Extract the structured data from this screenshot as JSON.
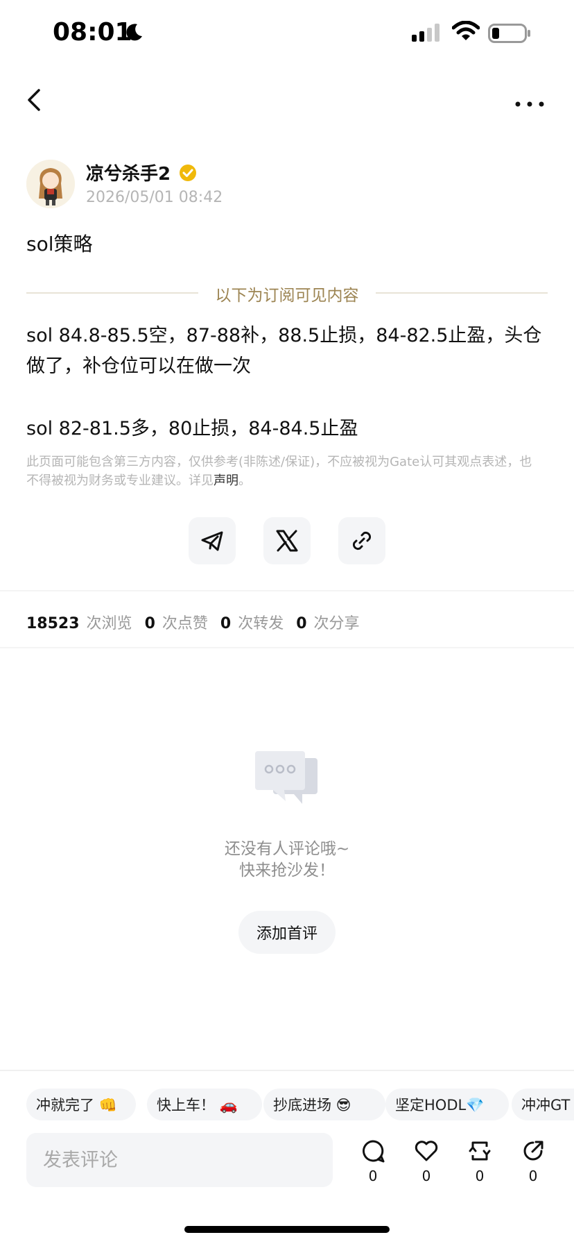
{
  "status_bar": {
    "time": "08:01"
  },
  "author": {
    "name": "凉兮杀手2",
    "post_time": "2026/05/01 08:42"
  },
  "post": {
    "title": "sol策略",
    "divider_text": "以下为订阅可见内容",
    "paragraphs": [
      "sol 84.8-85.5空，87-88补，88.5止损，84-82.5止盈，头仓做了，补仓位可以在做一次",
      "sol 82-81.5多，80止损，84-84.5止盈"
    ],
    "disclaimer": "此页面可能包含第三方内容，仅供参考(非陈述/保证)，不应被视为Gate认可其观点表述，也不得被视为财务或专业建议。详见",
    "disclaimer_link": "声明",
    "disclaimer_end": "。"
  },
  "share": {
    "icons": [
      "telegram-icon",
      "x-icon",
      "link-icon"
    ]
  },
  "stats": {
    "views": "18523",
    "views_label": "次浏览",
    "likes": "0",
    "likes_label": "次点赞",
    "reposts": "0",
    "reposts_label": "次转发",
    "shares": "0",
    "shares_label": "次分享"
  },
  "empty_comments": {
    "line1": "还没有人评论哦~",
    "line2": "快来抢沙发！",
    "button": "添加首评"
  },
  "quick_replies": [
    "冲就完了 👊",
    "快上车！ 🚗",
    "抄底进场 😎",
    "坚定HODL💎",
    "冲冲GT"
  ],
  "bottom_bar": {
    "comment_placeholder": "发表评论",
    "comment_count": "0",
    "like_count": "0",
    "repost_count": "0",
    "share_count": "0"
  },
  "colors": {
    "divider_text": "#9c8452",
    "verified_badge": "#f0b90b",
    "muted_text": "#b5b5b5"
  }
}
